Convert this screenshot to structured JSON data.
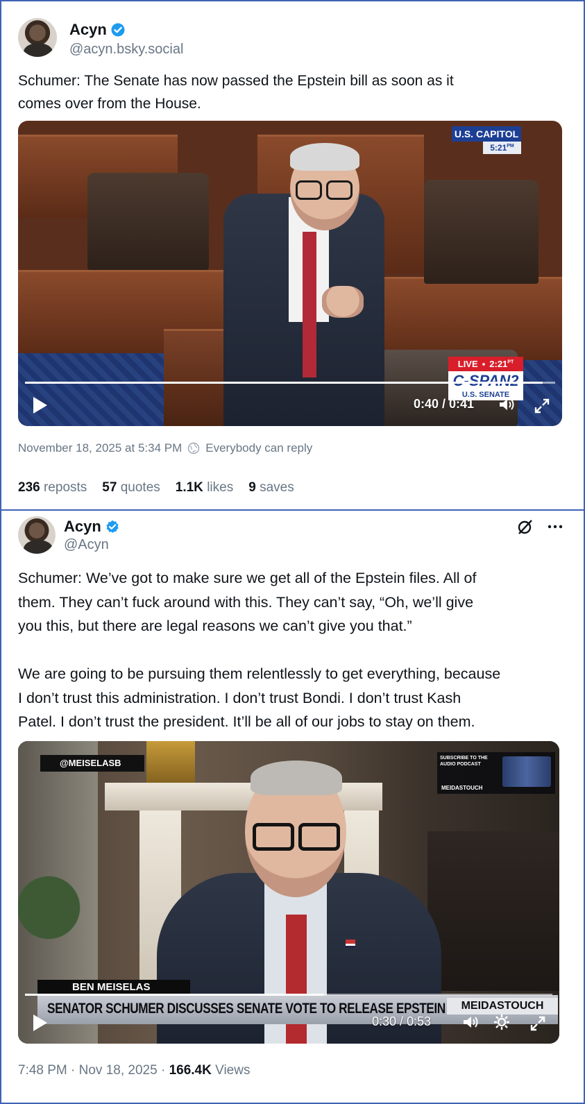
{
  "post1": {
    "author_name": "Acyn",
    "handle": "@acyn.bsky.social",
    "text": "Schumer: The Senate has now passed the Epstein bill as soon as it\ncomes over from the House.",
    "video": {
      "chyron_location": "U.S. CAPITOL",
      "chyron_time": "5:21",
      "chyron_time_suffix": "PM",
      "live_label": "LIVE",
      "live_time": "2:21",
      "live_time_suffix": "PT",
      "network_label": "C-SPAN2",
      "network_sub": "U.S. SENATE",
      "timecode": "0:40 / 0:41",
      "progress_fraction": 0.976
    },
    "timestamp": "November 18, 2025 at 5:34 PM",
    "reply_setting": "Everybody can reply",
    "stats": [
      {
        "count": "236",
        "label": "reposts"
      },
      {
        "count": "57",
        "label": "quotes"
      },
      {
        "count": "1.1K",
        "label": "likes"
      },
      {
        "count": "9",
        "label": "saves"
      }
    ]
  },
  "post2": {
    "author_name": "Acyn",
    "handle": "@Acyn",
    "text": "Schumer: We’ve got to make sure we get all of the Epstein files. All of\nthem. They can’t fuck around with this. They can’t say, “Oh, we’ll give\nyou this, but there are legal reasons we can’t give you that.”\n\nWe are going to be pursuing them relentlessly to get everything, because\nI don’t trust this administration. I don’t trust Bondi. I don’t trust Kash\nPatel. I don’t trust the president. It’ll be all of our jobs to stay on them.",
    "video": {
      "watermark": "@MEISELASB",
      "promo_line1": "SUBSCRIBE TO THE",
      "promo_line2": "AUDIO PODCAST",
      "promo_brand": "MEIDASTOUCH",
      "name_tag": "BEN MEISELAS",
      "headline": "SENATOR SCHUMER DISCUSSES SENATE VOTE TO RELEASE EPSTEIN",
      "brand": "MEIDASTOUCH",
      "timecode": "0:30 / 0:53",
      "progress_fraction": 0.566
    },
    "footer_time": "7:48 PM · Nov 18, 2025 · ",
    "views_count": "166.4K",
    "views_label": "Views"
  },
  "colors": {
    "border": "#3f62b5",
    "verified": "#1d9bf0",
    "muted": "#687684"
  }
}
